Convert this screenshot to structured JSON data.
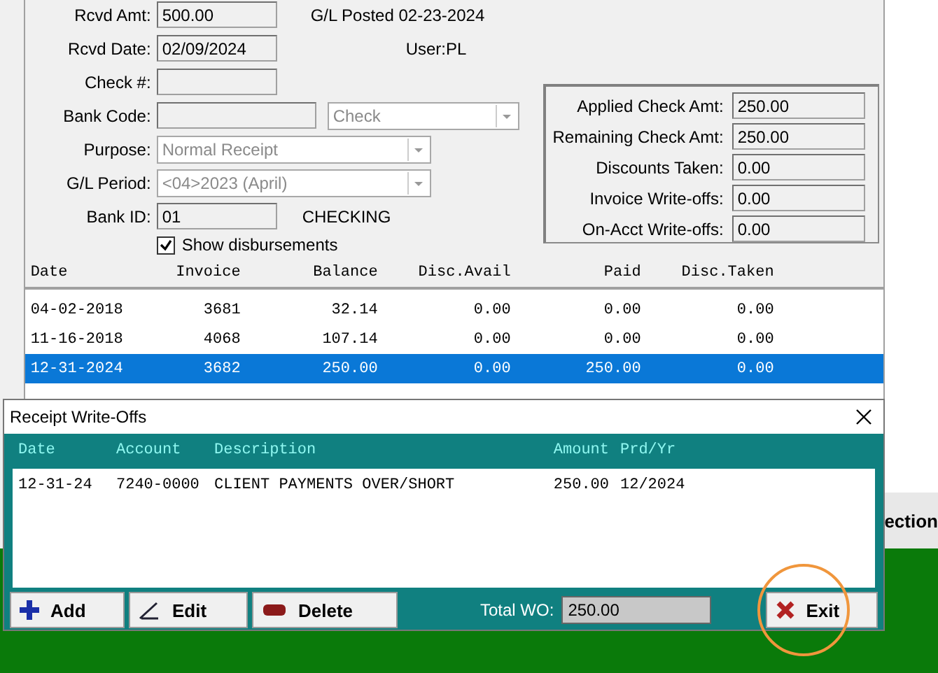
{
  "form": {
    "rows": [
      {
        "label": "Rcvd Amt:",
        "kind": "input",
        "value": "500.00",
        "note": "G/L Posted 02-23-2024"
      },
      {
        "label": "Rcvd Date:",
        "kind": "input",
        "value": "02/09/2024",
        "note": "User:PL"
      },
      {
        "label": "Check #:",
        "kind": "input",
        "value": ""
      },
      {
        "label": "Bank Code:",
        "kind": "input_select",
        "value": "",
        "select": {
          "value": "Check",
          "disabled": true
        }
      },
      {
        "label": "Purpose:",
        "kind": "select",
        "value": "Normal Receipt",
        "disabled": true
      },
      {
        "label": "G/L Period:",
        "kind": "select",
        "value": "<04>2023 (April)",
        "disabled": true
      },
      {
        "label": "Bank ID:",
        "kind": "input",
        "value": "01",
        "note": "CHECKING"
      }
    ],
    "checkbox": {
      "label": "Show disbursements",
      "checked": true
    }
  },
  "summary": [
    {
      "label": "Applied Check Amt:",
      "value": "250.00"
    },
    {
      "label": "Remaining Check Amt:",
      "value": "250.00"
    },
    {
      "label": "Discounts Taken:",
      "value": "0.00"
    },
    {
      "label": "Invoice Write-offs:",
      "value": "0.00"
    },
    {
      "label": "On-Acct Write-offs:",
      "value": "0.00"
    }
  ],
  "table": {
    "columns": [
      "Date",
      "Invoice",
      "Balance",
      "Disc.Avail",
      "Paid",
      "Disc.Taken"
    ],
    "rows": [
      {
        "cells": [
          "04-02-2018",
          "3681",
          "32.14",
          "0.00",
          "0.00",
          "0.00"
        ],
        "selected": false
      },
      {
        "cells": [
          "11-16-2018",
          "4068",
          "107.14",
          "0.00",
          "0.00",
          "0.00"
        ],
        "selected": false
      },
      {
        "cells": [
          "12-31-2024",
          "3682",
          "250.00",
          "0.00",
          "250.00",
          "0.00"
        ],
        "selected": true
      }
    ]
  },
  "background_fragment": "ection",
  "dialog": {
    "title": "Receipt Write-Offs",
    "columns": [
      "Date",
      "Account",
      "Description",
      "Amount",
      "Prd/Yr"
    ],
    "rows": [
      {
        "cells": [
          "12-31-24",
          "7240-0000",
          "CLIENT PAYMENTS OVER/SHORT",
          "250.00",
          "12/2024"
        ]
      }
    ],
    "buttons": [
      {
        "label": "Add",
        "kind": "add"
      },
      {
        "label": "Edit",
        "kind": "edit"
      },
      {
        "label": "Delete",
        "kind": "delete"
      }
    ],
    "total": {
      "label": "Total WO:",
      "value": "250.00"
    },
    "exit": {
      "label": "Exit",
      "highlighted": true
    }
  }
}
